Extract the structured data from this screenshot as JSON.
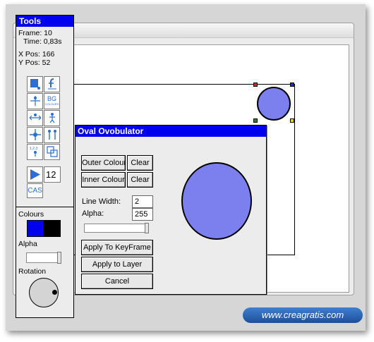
{
  "tools_panel": {
    "title": "Tools",
    "frame_label": "Frame: 10",
    "time_label": "Time: 0,83s",
    "xpos_label": "X Pos: 166",
    "ypos_label": "Y Pos: 52",
    "tool_icons": [
      "draw-oval-icon",
      "function-icon",
      "move-all-icon",
      "bg-colours-icon",
      "move-horizontal-icon",
      "figure-icon",
      "move-cross-icon",
      "figure-pair-icon",
      "sequence-icon",
      "layer-icon"
    ],
    "tool_texts": {
      "bg": "BG",
      "colours_small": "COLOURS"
    },
    "frame_number": "12",
    "cas_label": "CAS",
    "colours_label": "Colours",
    "alpha_label": "Alpha",
    "rotation_label": "Rotation",
    "colour_primary": "#0000ee",
    "colour_secondary": "#000000"
  },
  "dialog": {
    "title": "Oval Ovobulator",
    "outer_colour_button": "Outer Colour",
    "outer_clear_button": "Clear",
    "inner_colour_button": "Inner Colour",
    "inner_clear_button": "Clear",
    "line_width_label": "Line Width:",
    "line_width_value": "2",
    "alpha_label": "Alpha:",
    "alpha_value": "255",
    "apply_keyframe_button": "Apply To KeyFrame",
    "apply_layer_button": "Apply to Layer",
    "cancel_button": "Cancel",
    "oval_fill": "#7b80ee"
  },
  "stage": {
    "handle_colors": [
      "#dd2222",
      "#1a2ad0",
      "#1f8a2e",
      "#e6d400"
    ]
  },
  "watermark": {
    "text": "www.creagratis.com"
  }
}
